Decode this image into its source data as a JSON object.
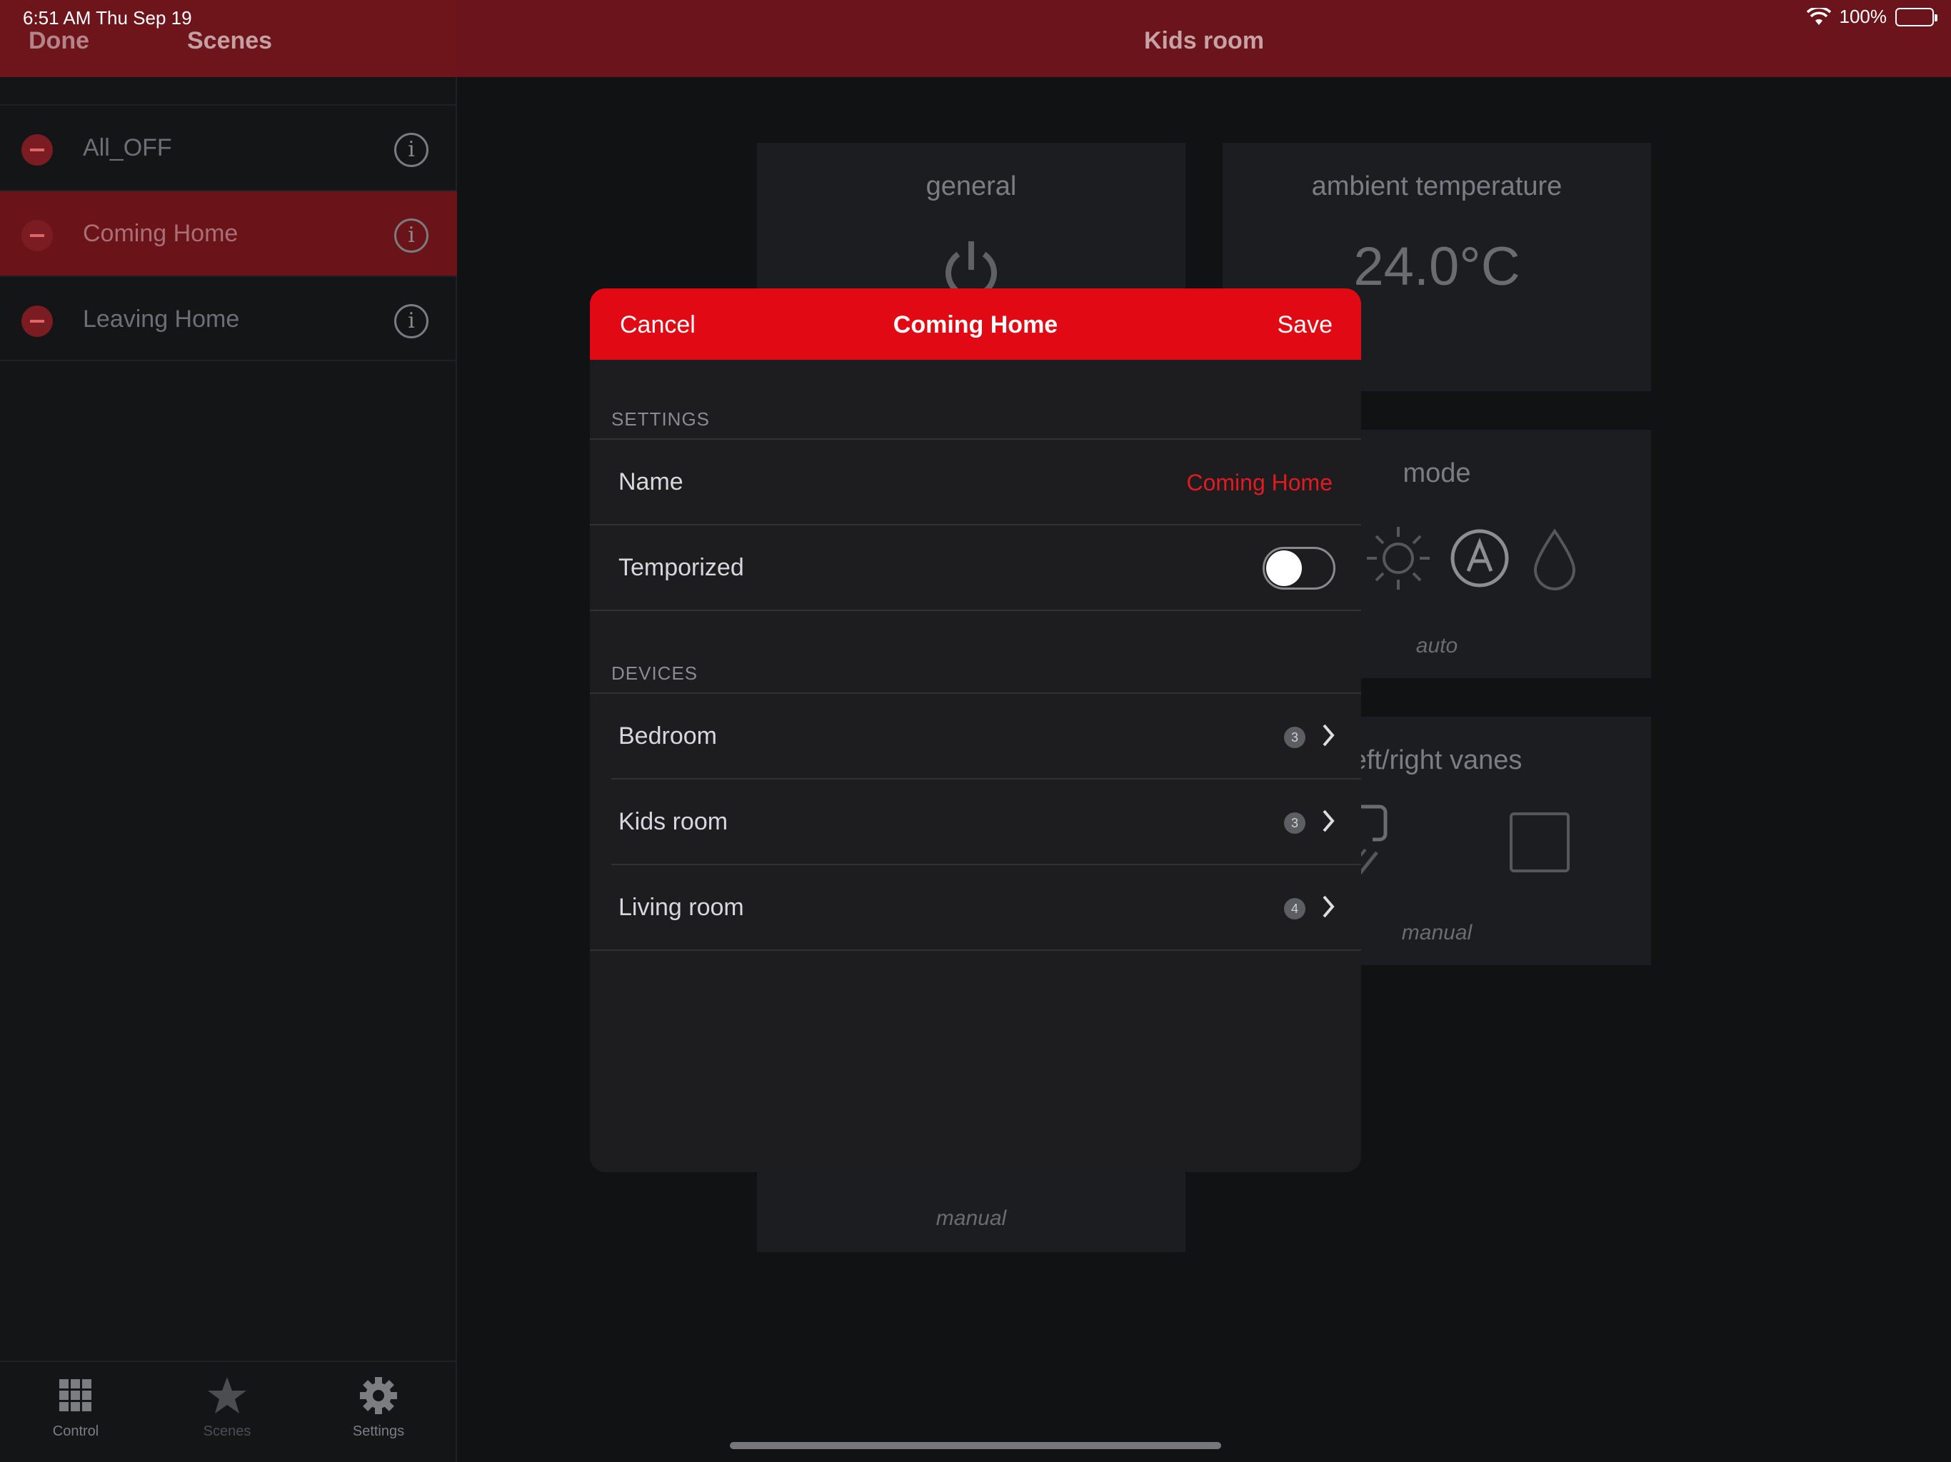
{
  "status": {
    "time": "6:51 AM   Thu Sep 19",
    "battery": "100%"
  },
  "nav": {
    "done": "Done",
    "scenes": "Scenes",
    "title": "Kids room"
  },
  "scenes": [
    {
      "label": "All_OFF",
      "selected": false
    },
    {
      "label": "Coming Home",
      "selected": true
    },
    {
      "label": "Leaving Home",
      "selected": false
    }
  ],
  "tabs": [
    {
      "label": "Control",
      "icon": "grid-icon"
    },
    {
      "label": "Scenes",
      "icon": "star-icon"
    },
    {
      "label": "Settings",
      "icon": "gear-icon"
    }
  ],
  "cards": {
    "general": {
      "title": "general",
      "sub": "manual"
    },
    "ambient": {
      "title": "ambient temperature",
      "value": "24.0°C"
    },
    "mode": {
      "title": "mode",
      "sub": "auto"
    },
    "vanes": {
      "title": "eft/right vanes",
      "sub": "manual"
    }
  },
  "modal": {
    "cancel": "Cancel",
    "title": "Coming Home",
    "save": "Save",
    "settings_header": "SETTINGS",
    "name_label": "Name",
    "name_value": "Coming Home",
    "temporized_label": "Temporized",
    "temporized_on": false,
    "devices_header": "DEVICES",
    "devices": [
      {
        "label": "Bedroom",
        "count": "3"
      },
      {
        "label": "Kids room",
        "count": "3"
      },
      {
        "label": "Living room",
        "count": "4"
      }
    ]
  },
  "colors": {
    "accent": "#e10913",
    "nav_bar": "#6b141b",
    "background": "#111214"
  }
}
